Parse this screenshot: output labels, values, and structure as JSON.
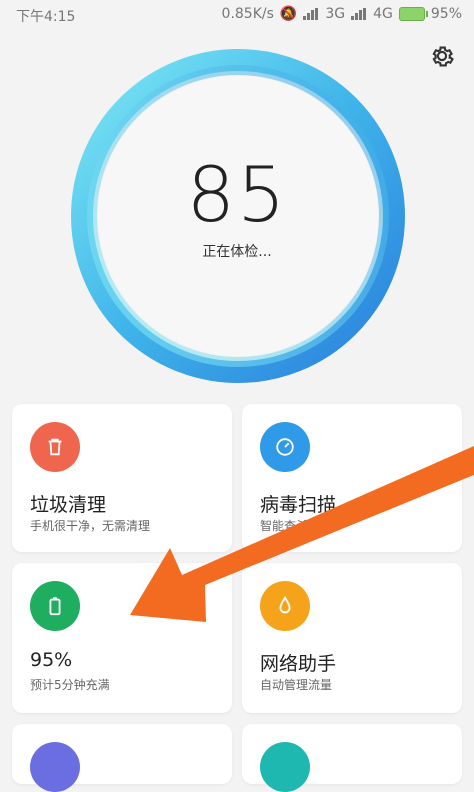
{
  "status_bar": {
    "time": "下午4:15",
    "net_speed": "0.85K/s",
    "network_3g": "3G",
    "network_4g": "4G",
    "battery": "95%"
  },
  "header": {
    "score": "85",
    "status_text": "正在体检..."
  },
  "cards": [
    {
      "title": "垃圾清理",
      "subtitle": "手机很干净，无需清理",
      "color": "#f0654e",
      "icon": "trash-icon"
    },
    {
      "title": "病毒扫描",
      "subtitle": "智能查杀",
      "color": "#2f9be8",
      "icon": "gauge-icon"
    },
    {
      "title": "95%",
      "subtitle": "预计5分钟充满",
      "color": "#1fae5f",
      "icon": "battery-icon"
    },
    {
      "title": "网络助手",
      "subtitle": "自动管理流量",
      "color": "#f6a31c",
      "icon": "droplet-icon"
    }
  ],
  "colors": {
    "arrow": "#f26b21",
    "ring_outer": "#2b8fe0",
    "ring_inner": "#6ee6f2"
  }
}
